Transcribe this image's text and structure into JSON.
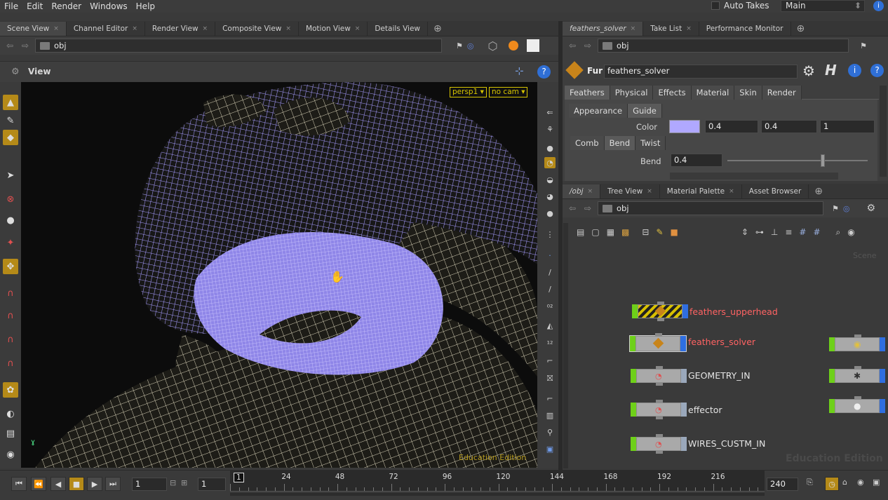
{
  "menu": [
    "File",
    "Edit",
    "Render",
    "Windows",
    "Help"
  ],
  "auto_takes_label": "Auto Takes",
  "desktop": "Main",
  "left_tabs": [
    "Scene View",
    "Channel Editor",
    "Render View",
    "Composite View",
    "Motion View",
    "Details View"
  ],
  "left_path": "obj",
  "view_label": "View",
  "camera": "persp1",
  "cam_menu": "no cam",
  "watermark": "Education Edition",
  "right_tabs": [
    "feathers_solver",
    "Take List",
    "Performance Monitor"
  ],
  "param_path": "obj",
  "node_type": "Fur",
  "node_name": "feathers_solver",
  "param_tabs": [
    "Feathers",
    "Physical",
    "Effects",
    "Material",
    "Skin",
    "Render"
  ],
  "sub_tabs": [
    "Appearance",
    "Guide"
  ],
  "color_label": "Color",
  "color_swatch": "#b0a8ff",
  "color_values": [
    "0.4",
    "0.4",
    "1"
  ],
  "sub_tabs2": [
    "Comb",
    "Bend",
    "Twist"
  ],
  "bend_label": "Bend",
  "bend_value": "0.4",
  "bend_slider_fraction": 0.68,
  "net_tabs": [
    "/obj",
    "Tree View",
    "Material Palette",
    "Asset Browser"
  ],
  "net_path": "obj",
  "net_corner": "Scene",
  "nodes": [
    {
      "label": "feathers_upperhead",
      "state": "bypassed"
    },
    {
      "label": "feathers_solver",
      "state": "selected"
    },
    {
      "label": "GEOMETRY_IN",
      "state": "normal"
    },
    {
      "label": "effector",
      "state": "normal"
    },
    {
      "label": "WIRES_CUSTM_IN",
      "state": "normal"
    }
  ],
  "net_watermark": "Education Edition",
  "frame_current": "1",
  "frame_step": "1",
  "frame_start": "1",
  "frame_marks": [
    "1",
    "24",
    "48",
    "72",
    "96",
    "120",
    "144",
    "168",
    "192",
    "216"
  ],
  "frame_end": "240",
  "colors": {
    "accent": "#b58a18",
    "wire": "#a79cff",
    "mesh": "#d8d2b8",
    "node_green": "#6ed019",
    "node_blue": "#2f6ee0"
  }
}
